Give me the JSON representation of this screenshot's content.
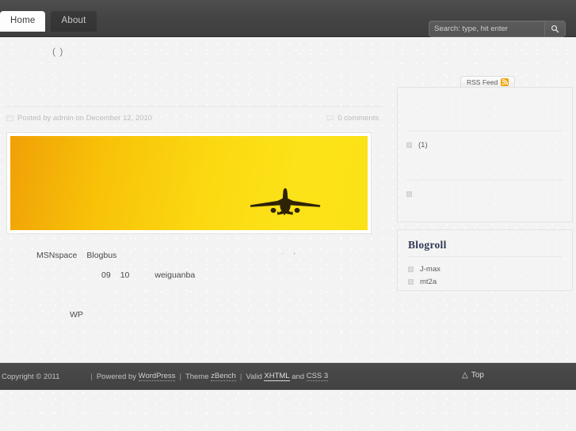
{
  "header": {
    "tabs": [
      {
        "label": "Home",
        "active": true
      },
      {
        "label": "About",
        "active": false
      }
    ],
    "search": {
      "placeholder": "Search: type, hit enter",
      "value": "",
      "button_icon": "search-icon"
    }
  },
  "post": {
    "title": "( )",
    "meta_author": "Posted by admin on December 12, 2010",
    "meta_comments": "0 comments",
    "banner": {
      "alt": "airplane silhouette against yellow sunset sky",
      "gradient_left": "#f0a007",
      "gradient_right": "#fbe216",
      "plane_color": "#2b2208"
    },
    "body": {
      "line1_a": "MSNspace",
      "line1_b": "Blogbus",
      "line2_a": "09",
      "line2_b": "10",
      "line2_c": "weiguanba",
      "line3": "WP",
      "tofu": "▫ ▪"
    }
  },
  "sidebar": {
    "rss_tab_label": "RSS Feed",
    "rss_tab_icon": "rss-icon",
    "archives": {
      "rows": [
        {
          "label": "(1)",
          "icon": "bullet-icon"
        },
        {
          "label": "",
          "icon": "bullet-icon"
        }
      ]
    },
    "blogroll": {
      "title": "Blogroll",
      "links": [
        {
          "label": "J-max",
          "icon": "bullet-icon"
        },
        {
          "label": "mt2a",
          "icon": "bullet-icon"
        }
      ]
    }
  },
  "footer": {
    "copyright": "Copyright © 2011",
    "sep": "|",
    "powered_prefix": "Powered by",
    "powered_link": "WordPress",
    "theme_prefix": "Theme",
    "theme_link": "zBench",
    "valid_prefix": "Valid",
    "xhtml_link": "XHTML",
    "and_text": "and",
    "css_link": "CSS 3",
    "top_label": "Top",
    "top_icon": "triangle-up-icon"
  }
}
